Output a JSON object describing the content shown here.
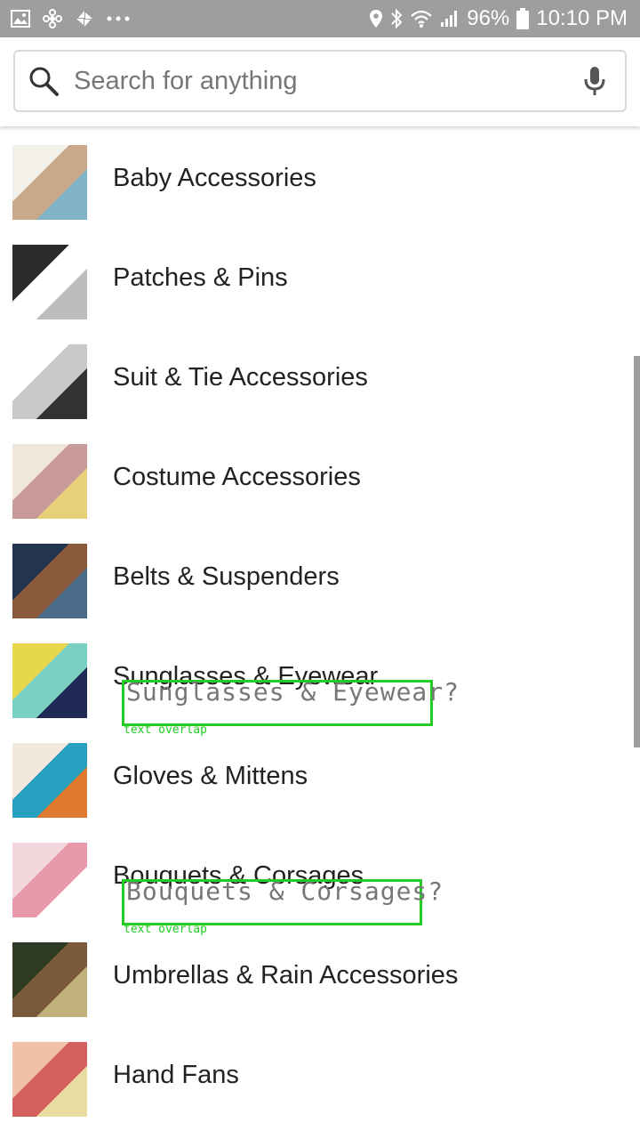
{
  "status_bar": {
    "left_icons": [
      "image-icon",
      "pinwheel-icon",
      "sync-icon",
      "more-dots-icon"
    ],
    "battery": "96%",
    "time": "10:10 PM",
    "right_icons": [
      "location-icon",
      "bluetooth-icon",
      "wifi-icon",
      "signal-icon",
      "battery-icon"
    ]
  },
  "search": {
    "placeholder": "Search for anything",
    "icon": "search-icon",
    "mic_icon": "mic-icon"
  },
  "categories": [
    {
      "label": "Baby Accessories",
      "thumb_colors": [
        "#f4f0ea",
        "#c9a98a",
        "#7fb3c5"
      ]
    },
    {
      "label": "Patches & Pins",
      "thumb_colors": [
        "#2a2a2a",
        "#ffffff",
        "#bdbdbd"
      ]
    },
    {
      "label": "Suit & Tie Accessories",
      "thumb_colors": [
        "#ffffff",
        "#c9c9c9",
        "#333333"
      ]
    },
    {
      "label": "Costume Accessories",
      "thumb_colors": [
        "#f0e6dc",
        "#c89a9a",
        "#e8d07a"
      ]
    },
    {
      "label": "Belts & Suspenders",
      "thumb_colors": [
        "#23344f",
        "#8a5a3a",
        "#4a6a8a"
      ]
    },
    {
      "label": "Sunglasses & Eyewear",
      "thumb_colors": [
        "#e6d84a",
        "#7ad0c2",
        "#1e2a55"
      ]
    },
    {
      "label": "Gloves & Mittens",
      "thumb_colors": [
        "#f2e8dc",
        "#2aa0c0",
        "#e07a30"
      ]
    },
    {
      "label": "Bouquets & Corsages",
      "thumb_colors": [
        "#f3d6dc",
        "#e89aaa",
        "#ffffff"
      ]
    },
    {
      "label": "Umbrellas & Rain Accessories",
      "thumb_colors": [
        "#2f3a22",
        "#7a5a3a",
        "#c2b07a"
      ]
    },
    {
      "label": "Hand Fans",
      "thumb_colors": [
        "#f0c0a8",
        "#d46060",
        "#e8dca0"
      ]
    }
  ],
  "overlays": [
    {
      "text": "Sunglasses & Eyewear?",
      "caption": "text overlap"
    },
    {
      "text": "Bouquets & Corsages?",
      "caption": "text overlap"
    }
  ],
  "colors": {
    "status_bar": "#9e9e9e",
    "overlay_green": "#22cc22",
    "scrollbar": "#9e9e9e"
  }
}
